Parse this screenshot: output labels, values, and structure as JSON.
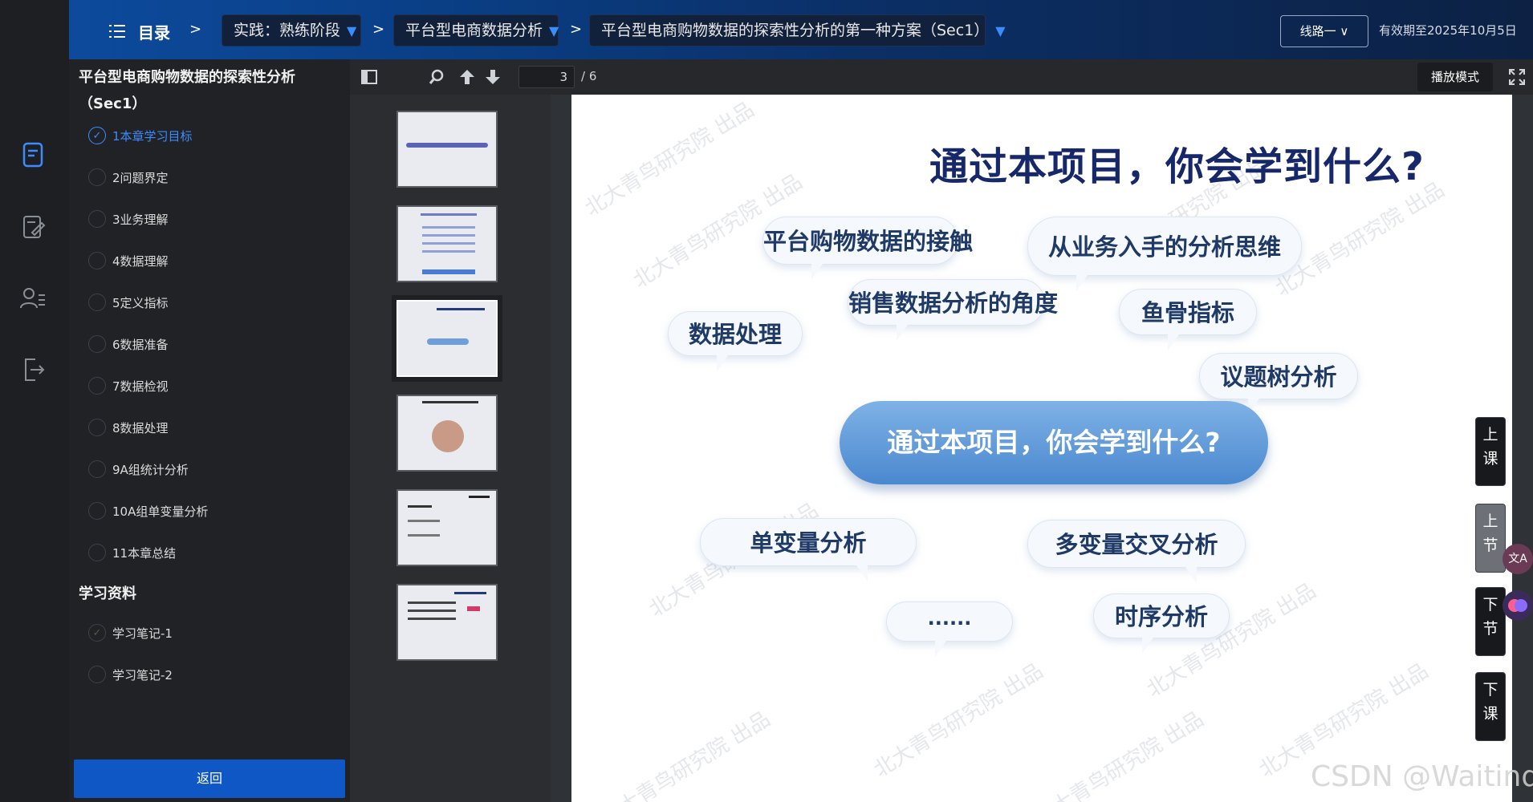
{
  "header": {
    "toc_label": "目录",
    "breadcrumbs": [
      {
        "label": "实践：熟练阶段",
        "arrow": "▼"
      },
      {
        "label": "平台型电商数据分析",
        "arrow": "▼"
      },
      {
        "label": "平台型电商购物数据的探索性分析的第一种方案（Sec1）",
        "arrow": "▼"
      }
    ],
    "separator": ">",
    "route_label": "线路一",
    "route_arrow": "∨",
    "expiry": "有效期至2025年10月5日"
  },
  "sidebar": {
    "course_title": "平台型电商购物数据的探索性分析（Sec1）",
    "chapters": [
      {
        "label": "1本章学习目标",
        "state": "active"
      },
      {
        "label": "2问题界定"
      },
      {
        "label": "3业务理解"
      },
      {
        "label": "4数据理解"
      },
      {
        "label": "5定义指标"
      },
      {
        "label": "6数据准备"
      },
      {
        "label": "7数据检视"
      },
      {
        "label": "8数据处理"
      },
      {
        "label": "9A组统计分析"
      },
      {
        "label": "10A组单变量分析"
      },
      {
        "label": "11本章总结"
      }
    ],
    "materials_title": "学习资料",
    "materials": [
      {
        "label": "学习笔记-1",
        "state": "done"
      },
      {
        "label": "学习笔记-2"
      }
    ],
    "back_label": "返回"
  },
  "toolbar": {
    "current_page": "3",
    "total_pages": "/ 6",
    "play_mode_label": "播放模式"
  },
  "slide": {
    "title": "通过本项目，你会学到什么?",
    "center": "通过本项目，你会学到什么?",
    "bubbles": [
      "平台购物数据的接触",
      "从业务入手的分析思维",
      "销售数据分析的角度",
      "鱼骨指标",
      "数据处理",
      "议题树分析",
      "单变量分析",
      "多变量交叉分析",
      "......",
      "时序分析"
    ],
    "watermark": "北大青鸟研究院 出品"
  },
  "right_nav": {
    "prev_lesson": [
      "上",
      "课"
    ],
    "prev_section": [
      "上",
      "节"
    ],
    "next_section": [
      "下",
      "节"
    ],
    "next_lesson": [
      "下",
      "课"
    ],
    "translate_label": "文A"
  },
  "overlay_watermark": "CSDN @Waitind"
}
